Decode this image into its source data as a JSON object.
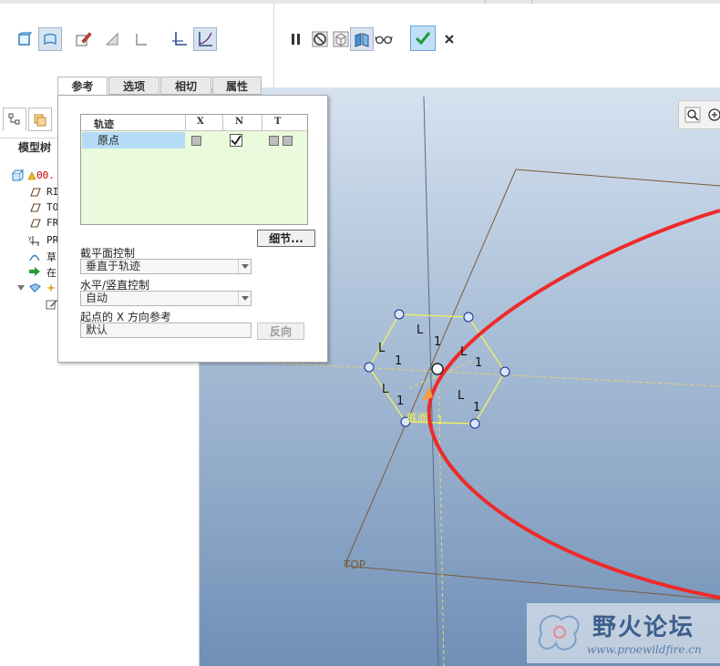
{
  "ribbon": {
    "buttons": [
      {
        "name": "solid-toggle",
        "pressed": false
      },
      {
        "name": "surface-toggle",
        "pressed": true
      },
      {
        "name": "sketch",
        "pressed": false
      },
      {
        "name": "remove-material",
        "pressed": false
      },
      {
        "name": "thicken",
        "pressed": false
      },
      {
        "name": "constant-section",
        "pressed": false
      },
      {
        "name": "variable-section",
        "pressed": true
      }
    ],
    "right_buttons": [
      "pause",
      "no-preview",
      "verify-model",
      "preview-geometry",
      "glasses-preview",
      "ok",
      "cancel"
    ]
  },
  "model_tree": {
    "title": "模型树",
    "items": [
      {
        "label": "00.",
        "icon": "part-icon",
        "red": true,
        "indent": 0
      },
      {
        "label": "RI",
        "icon": "datum-plane-icon",
        "red": false,
        "indent": 1
      },
      {
        "label": "TO",
        "icon": "datum-plane-icon",
        "red": false,
        "indent": 1
      },
      {
        "label": "FR",
        "icon": "datum-plane-icon",
        "red": false,
        "indent": 1
      },
      {
        "label": "PR",
        "icon": "csys-icon",
        "red": false,
        "indent": 1
      },
      {
        "label": "草",
        "icon": "sketch-icon",
        "red": false,
        "indent": 1
      },
      {
        "label": "在",
        "icon": "insert-here-arrow-icon",
        "red": false,
        "indent": 1
      },
      {
        "label": "",
        "icon": "sweep-feature-icon",
        "red": false,
        "indent": 1
      }
    ]
  },
  "ref_panel": {
    "tabs": [
      "参考",
      "选项",
      "相切",
      "属性"
    ],
    "active_tab": "参考",
    "table": {
      "headers": [
        "轨迹",
        "X",
        "N",
        "T"
      ],
      "rows": [
        {
          "name": "原点",
          "x": false,
          "n": true,
          "t": false
        }
      ]
    },
    "detail_button": "细节...",
    "section_plane_label": "截平面控制",
    "section_plane_value": "垂直于轨迹",
    "hv_control_label": "水平/竖直控制",
    "hv_control_value": "自动",
    "x_ref_label": "起点的 X 方向参考",
    "x_ref_value": "默认",
    "flip_button": "反向"
  },
  "viewport": {
    "plane_label": "TOP",
    "dimension_labels": [
      "L",
      "1",
      "L",
      "1",
      "L",
      "1",
      "L",
      "1",
      "L",
      "1"
    ],
    "start_label": "截面",
    "start_label_num": "1",
    "trajectory_color": "#ee2a2a"
  },
  "watermark": {
    "main": "野火论坛",
    "url": "www.proewildfire.cn"
  }
}
